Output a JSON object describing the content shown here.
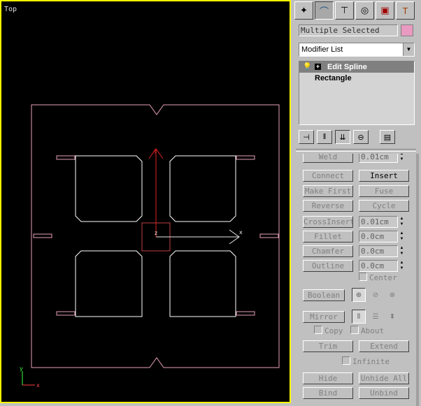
{
  "viewport": {
    "label": "Top",
    "border_color": "#ffff00"
  },
  "axis": {
    "x": "x",
    "y": "y",
    "z": "z"
  },
  "command_panel": {
    "tabs": [
      {
        "name": "create",
        "icon": "cursor-star-icon"
      },
      {
        "name": "modify",
        "icon": "bend-icon"
      },
      {
        "name": "hierarchy",
        "icon": "hierarchy-icon"
      },
      {
        "name": "motion",
        "icon": "motion-wheel-icon"
      },
      {
        "name": "display",
        "icon": "display-monitor-icon"
      },
      {
        "name": "utilities",
        "icon": "hammer-icon"
      }
    ],
    "selection_name": "Multiple Selected",
    "selection_color": "#e89ac0",
    "modifier_list": "Modifier List",
    "stack": [
      {
        "label": "Edit Spline",
        "selected": true
      },
      {
        "label": "Rectangle",
        "selected": false
      }
    ]
  },
  "geometry": {
    "weld_value": "0.01cm",
    "buttons": {
      "weld": "Weld",
      "connect": "Connect",
      "insert": "Insert",
      "make_first": "Make First",
      "fuse": "Fuse",
      "reverse": "Reverse",
      "cycle": "Cycle",
      "cross_insert": "CrossInsert",
      "fillet": "Fillet",
      "chamfer": "Chamfer",
      "outline": "Outline",
      "boolean": "Boolean",
      "mirror": "Mirror",
      "trim": "Trim",
      "extend": "Extend",
      "hide": "Hide",
      "unhide_all": "Unhide All",
      "bind": "Bind",
      "unbind": "Unbind"
    },
    "spinners": {
      "cross_insert": "0.01cm",
      "fillet": "0.0cm",
      "chamfer": "0.0cm",
      "outline": "0.0cm"
    },
    "checks": {
      "center": "Center",
      "copy": "Copy",
      "about": "About",
      "infinite": "Infinite"
    }
  }
}
